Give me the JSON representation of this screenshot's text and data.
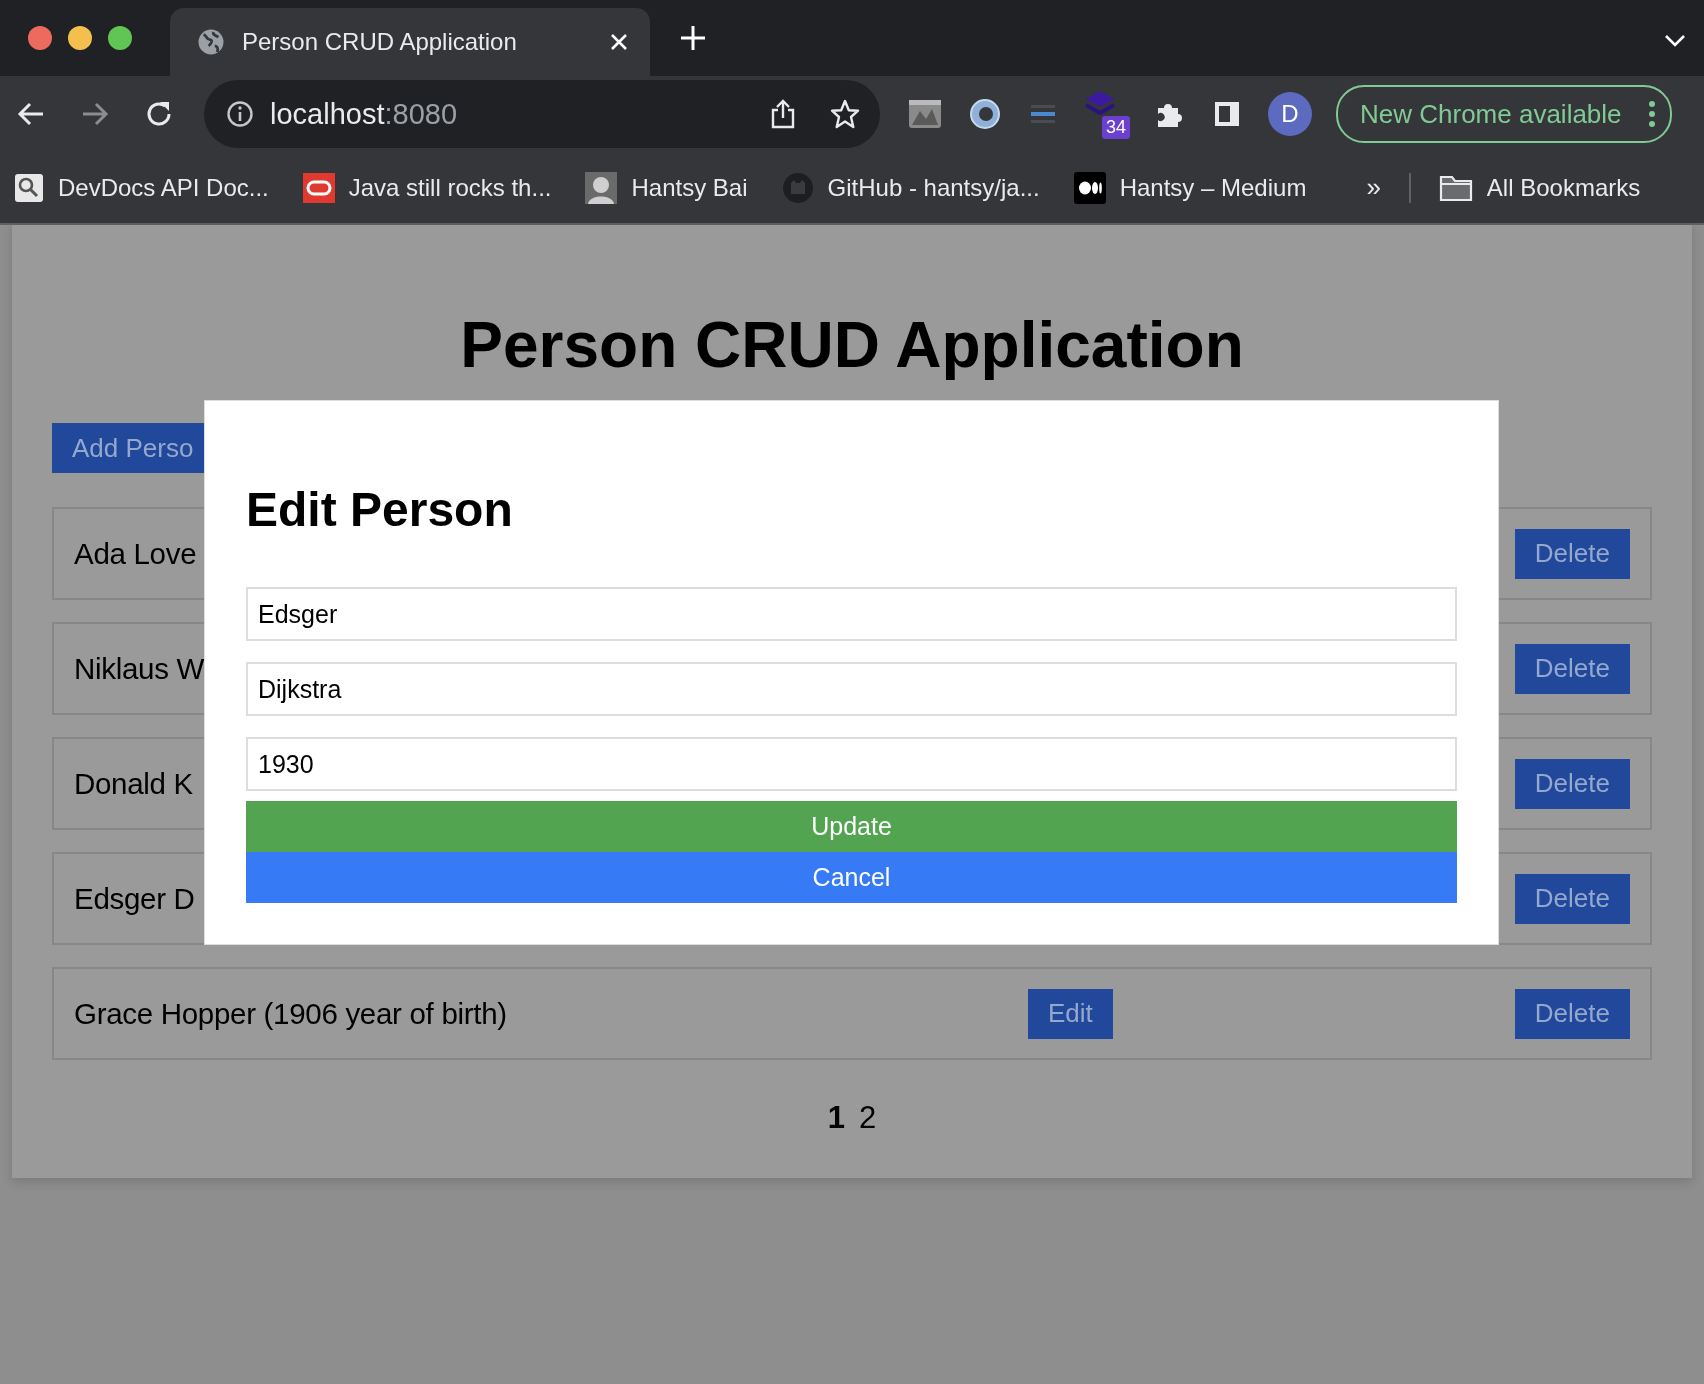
{
  "browser": {
    "tab_title": "Person CRUD Application",
    "url_host": "localhost",
    "url_port": ":8080",
    "profile_initial": "D",
    "extension_badge": "34",
    "update_label": "New Chrome available",
    "bookmarks": [
      {
        "kind": "search",
        "label": "DevDocs API Doc..."
      },
      {
        "kind": "oracle",
        "label": "Java still rocks th..."
      },
      {
        "kind": "portrait",
        "label": "Hantsy Bai"
      },
      {
        "kind": "github",
        "label": "GitHub - hantsy/ja..."
      },
      {
        "kind": "medium",
        "label": "Hantsy – Medium"
      }
    ],
    "more_bookmarks": "»",
    "all_bookmarks": "All Bookmarks"
  },
  "page": {
    "title": "Person CRUD Application",
    "add_button": "Add Perso",
    "people": [
      {
        "name": "Ada Love",
        "delete": "Delete"
      },
      {
        "name": "Niklaus W",
        "delete": "Delete"
      },
      {
        "name": "Donald K",
        "delete": "Delete"
      },
      {
        "name": "Edsger D",
        "delete": "Delete"
      },
      {
        "name": "Grace Hopper (1906 year of birth)",
        "edit": "Edit",
        "delete": "Delete"
      }
    ],
    "pagination": [
      {
        "label": "1",
        "selected": true
      },
      {
        "label": "2",
        "selected": false
      }
    ]
  },
  "modal": {
    "title": "Edit Person",
    "fields": [
      {
        "value": "Edsger"
      },
      {
        "value": "Dijkstra"
      },
      {
        "value": "1930"
      }
    ],
    "buttons": [
      {
        "kind": "update",
        "label": "Update"
      },
      {
        "kind": "cancel",
        "label": "Cancel"
      }
    ]
  }
}
